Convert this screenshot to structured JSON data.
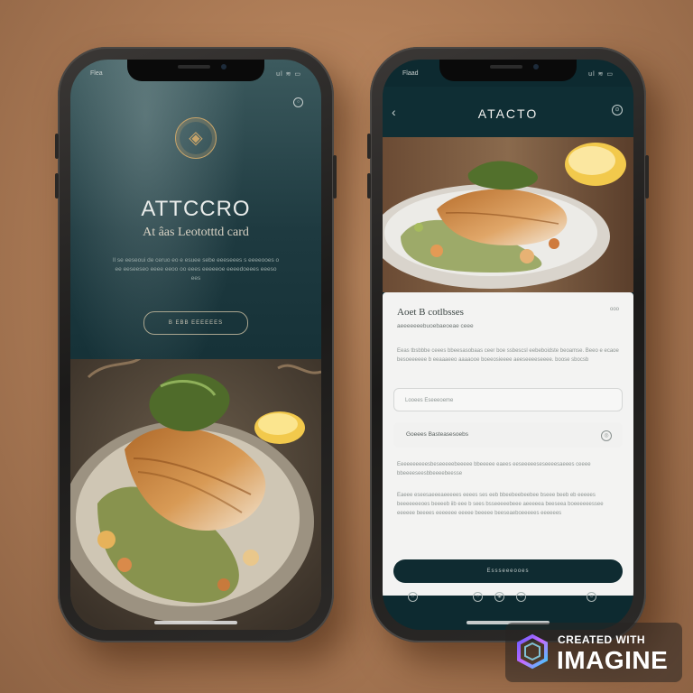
{
  "left_screen": {
    "status_time": "Flea",
    "status_icons": "ul ≋ ▭",
    "emblem_icon": "◈",
    "title": "ATTCCRO",
    "subtitle": "At âas Leototttd card",
    "paragraph": "Il se eeseoui de ceruo eo e esuee sebe eeeseees s eeeeooes o ee eeseeseo eeee eeoo oo eees eeeeeoe eeeedoeees eeeso ees",
    "button_label": "B EBB  EEEEEES"
  },
  "right_screen": {
    "status_time": "Flaad",
    "status_icons": "ul ≋ ▭",
    "back_icon": "‹",
    "title": "ATACTO",
    "settings_icon": "⊙",
    "card": {
      "title": "Aoet B cotlbsses",
      "badge": "ooo",
      "subtitle": "aeeeeeeebuoebaeoeae ceee",
      "description": "Eeas tbsbbbe ceees bbeesasobaas ceer boe ssbescsl eebeboidste beoamse. Beeo e ecaoe besoeeeeee b eeaaaeeo aaaaooe boeeosieeee aeeseeeeseeee. boose sbocsb",
      "input_value": "Looees    Eseeeoeme",
      "select_value": "Goeees  Basteasesoebs",
      "paragraph1": "Eeeeeeeeeesbeseeeeebeeeee bbeeeee eaees eeseeeeeseseeeesaeees ceeee bbeeeeseesbbeeeebeesse",
      "paragraph2": "Eaeee eseesaeeeaeeeees eeees ses eeb bbeebeebeebee bseee beeb eb eeeees beeeeeeeoes beeeeb iib eee b sees bsseeeeebeee aeeeeea beeseea boeeeeeessee eeeeee beeees eeeeeee eeeee beeeee beeseaeboeeeees eeeeees",
      "cta_label": "Essseeeooes"
    }
  },
  "watermark": {
    "line1": "CREATED WITH",
    "line2": "IMAGINE"
  },
  "colors": {
    "background": "#b07e58",
    "screen_dark": "#0f2e34",
    "card_bg": "#f3f3f2",
    "cta_bg": "#0f2b31",
    "gold_accent": "#c7a46a"
  }
}
